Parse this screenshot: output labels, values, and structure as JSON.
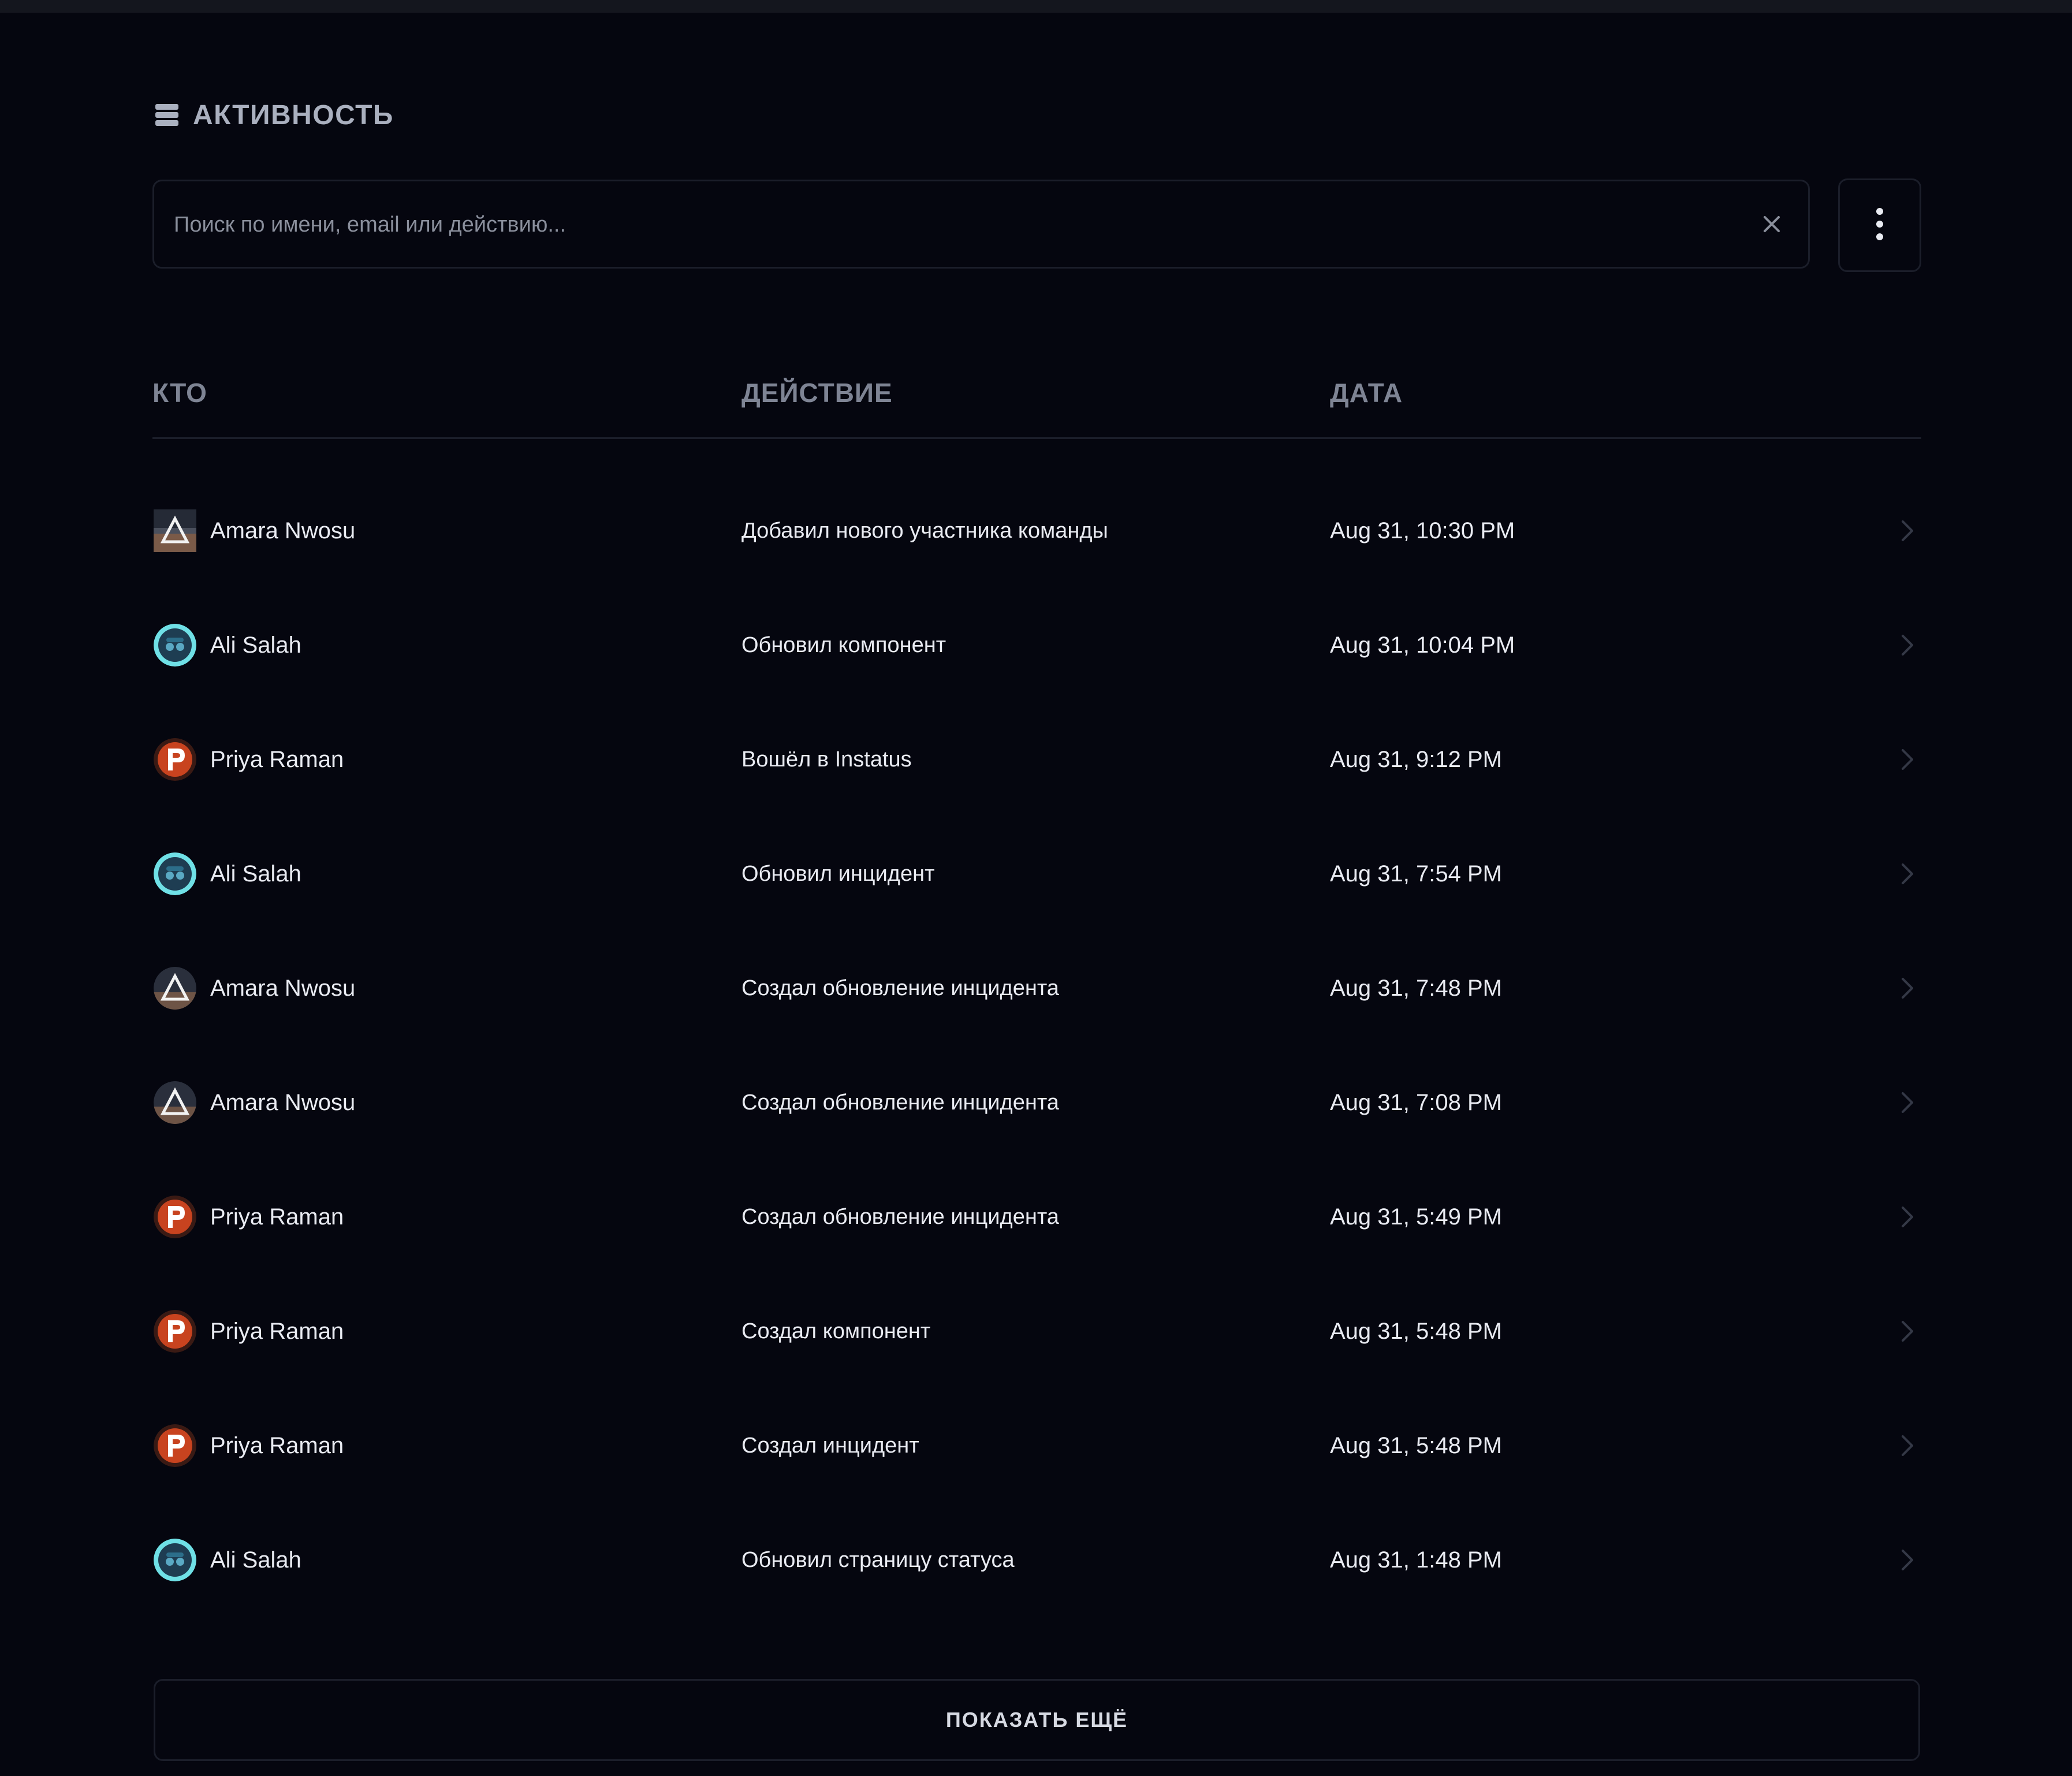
{
  "header": {
    "title": "АКТИВНОСТЬ",
    "icon": "layers-icon"
  },
  "search": {
    "value": "",
    "placeholder": "Поиск по имени, email или действию...",
    "clear_icon": "close-icon"
  },
  "menu": {
    "icon": "vertical-dots-icon"
  },
  "table": {
    "columns": {
      "who": "КТО",
      "action": "ДЕЙСТВИЕ",
      "date": "ДАТА"
    },
    "rows": [
      {
        "who": "Amara Nwosu",
        "action": "Добавил нового участника команды",
        "date": "Aug 31, 10:30 PM"
      },
      {
        "who": "Ali Salah",
        "action": "Обновил компонент",
        "date": "Aug 31, 10:04 PM"
      },
      {
        "who": "Priya Raman",
        "action": "Вошёл в Instatus",
        "date": "Aug 31, 9:12 PM"
      },
      {
        "who": "Ali Salah",
        "action": "Обновил инцидент",
        "date": "Aug 31, 7:54 PM"
      },
      {
        "who": "Amara Nwosu",
        "action": "Создал обновление инцидента",
        "date": "Aug 31, 7:48 PM"
      },
      {
        "who": "Amara Nwosu",
        "action": "Создал обновление инцидента",
        "date": "Aug 31, 7:08 PM"
      },
      {
        "who": "Priya Raman",
        "action": "Создал обновление инцидента",
        "date": "Aug 31, 5:49 PM"
      },
      {
        "who": "Priya Raman",
        "action": "Создал компонент",
        "date": "Aug 31, 5:48 PM"
      },
      {
        "who": "Priya Raman",
        "action": "Создал инцидент",
        "date": "Aug 31, 5:48 PM"
      },
      {
        "who": "Ali Salah",
        "action": "Обновил страницу статуса",
        "date": "Aug 31, 1:48 PM"
      }
    ]
  },
  "load_more": {
    "label": "ПОКАЗАТЬ ЕЩЁ"
  },
  "colors": {
    "background": "#05060f",
    "border": "#1b1e2a",
    "text": "#e9ebf2",
    "muted": "#7e8494"
  }
}
